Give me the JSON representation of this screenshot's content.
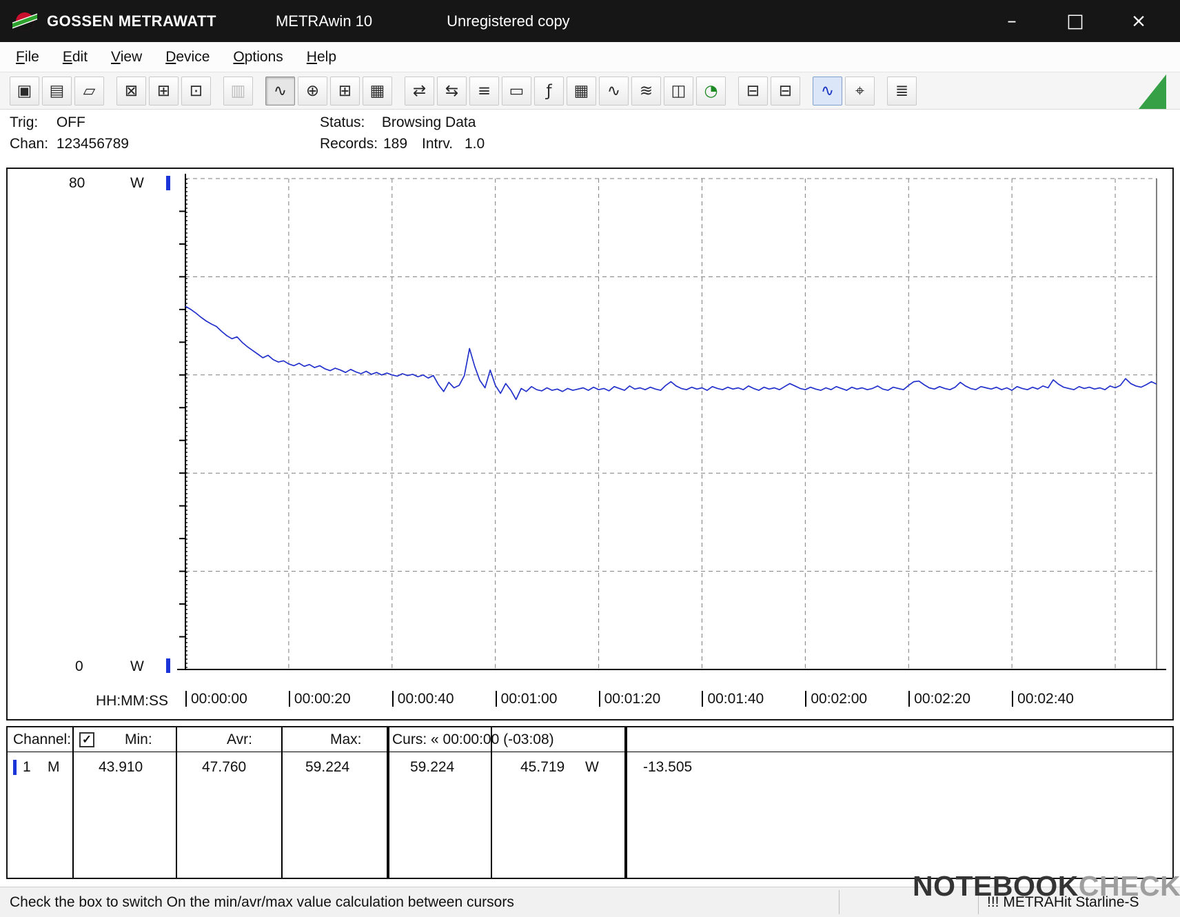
{
  "titlebar": {
    "brand": "GOSSEN METRAWATT",
    "app": "METRAwin 10",
    "license": "Unregistered copy",
    "controls": {
      "minimize": "–",
      "maximize": "□",
      "close": "×"
    }
  },
  "menu": {
    "items": [
      "File",
      "Edit",
      "View",
      "Device",
      "Options",
      "Help"
    ]
  },
  "toolbar": {
    "buttons": [
      {
        "name": "save-button",
        "icon": "floppy-save-icon",
        "glyph": "▣"
      },
      {
        "name": "save-as-button",
        "icon": "floppy-edit-icon",
        "glyph": "▤"
      },
      {
        "name": "open-button",
        "icon": "open-folder-icon",
        "glyph": "▱"
      },
      {
        "sep": true
      },
      {
        "name": "export-data-button",
        "icon": "export-box-icon",
        "glyph": "⊠"
      },
      {
        "name": "delete-data-button",
        "icon": "delete-box-icon",
        "glyph": "⊞"
      },
      {
        "name": "import-data-button",
        "icon": "import-box-icon",
        "glyph": "⊡"
      },
      {
        "sep": true
      },
      {
        "name": "numeric-display-button",
        "icon": "numeric-display-icon",
        "glyph": "▥",
        "state": "disabled"
      },
      {
        "sep": true
      },
      {
        "name": "line-chart-view-button",
        "icon": "line-chart-icon",
        "glyph": "∿",
        "state": "pressed"
      },
      {
        "name": "xy-view-button",
        "icon": "crosshair-icon",
        "glyph": "⊕"
      },
      {
        "name": "table-view-button",
        "icon": "table-grid-icon",
        "glyph": "⊞"
      },
      {
        "name": "histogram-view-button",
        "icon": "histogram-icon",
        "glyph": "▦"
      },
      {
        "sep": true
      },
      {
        "name": "device-settings-button",
        "icon": "device-transfer-icon",
        "glyph": "⇄"
      },
      {
        "name": "device-read-button",
        "icon": "device-read-icon",
        "glyph": "⇆"
      },
      {
        "name": "channel-select-button",
        "icon": "channel-list-icon",
        "glyph": "≡"
      },
      {
        "name": "monitor-button",
        "icon": "monitor-icon",
        "glyph": "▭"
      },
      {
        "name": "function-button",
        "icon": "function-fx-icon",
        "glyph": "ƒ"
      },
      {
        "name": "calculator-button",
        "icon": "calculator-icon",
        "glyph": "▦"
      },
      {
        "name": "waveform-small-button",
        "icon": "waveform-narrow-icon",
        "glyph": "∿"
      },
      {
        "name": "waveform-large-button",
        "icon": "waveform-wide-icon",
        "glyph": "≋"
      },
      {
        "name": "data-logger-button",
        "icon": "data-logger-icon",
        "glyph": "◫"
      },
      {
        "name": "timer-button",
        "icon": "stopwatch-icon",
        "glyph": "◔",
        "state": "green"
      },
      {
        "sep": true
      },
      {
        "name": "print-preview-button",
        "icon": "print-preview-icon",
        "glyph": "⊟"
      },
      {
        "name": "print-button",
        "icon": "printer-icon",
        "glyph": "⊟"
      },
      {
        "sep": true
      },
      {
        "name": "zoom-signal-button",
        "icon": "zoom-waveform-icon",
        "glyph": "∿",
        "state": "active"
      },
      {
        "name": "zoom-search-button",
        "icon": "zoom-lens-icon",
        "glyph": "⌖"
      },
      {
        "sep": true
      },
      {
        "name": "annotation-button",
        "icon": "note-icon",
        "glyph": "≣"
      }
    ]
  },
  "status_panel": {
    "trig_label": "Trig:",
    "trig_value": "OFF",
    "chan_label": "Chan:",
    "chan_value": "123456789",
    "status_label": "Status:",
    "status_value": "Browsing Data",
    "records_label": "Records:",
    "records_value": "189",
    "interval_label": "Intrv.",
    "interval_value": "1.0"
  },
  "chart_data": {
    "type": "line",
    "y_axis": {
      "max_label": "80",
      "min_label": "0",
      "unit": "W",
      "ylim": [
        0,
        80
      ],
      "gridline_values": [
        16,
        32,
        48,
        64
      ]
    },
    "x_axis": {
      "label": "HH:MM:SS",
      "tick_labels": [
        "00:00:00",
        "00:00:20",
        "00:00:40",
        "00:01:00",
        "00:01:20",
        "00:01:40",
        "00:02:00",
        "00:02:20",
        "00:02:40"
      ],
      "tick_interval_s": 20,
      "total_seconds": 188
    },
    "grid": true,
    "legend": "none",
    "cursors": {
      "left_s": 0,
      "right_s": 188
    },
    "series": [
      {
        "name": "channel-1-power-W",
        "color": "#2231cc",
        "interval_s": 1,
        "values": [
          59.2,
          58.7,
          58.1,
          57.4,
          56.8,
          56.3,
          55.9,
          55.1,
          54.4,
          53.9,
          54.2,
          53.3,
          52.6,
          52.0,
          51.4,
          50.8,
          51.2,
          50.5,
          50.1,
          50.3,
          49.8,
          49.5,
          49.9,
          49.4,
          49.7,
          49.2,
          49.5,
          49.0,
          48.7,
          49.1,
          48.8,
          48.4,
          48.9,
          48.5,
          48.2,
          48.6,
          48.1,
          48.4,
          48.0,
          48.3,
          48.0,
          47.8,
          48.2,
          47.9,
          48.1,
          47.7,
          48.0,
          47.5,
          47.9,
          46.4,
          45.3,
          46.8,
          45.9,
          46.3,
          47.9,
          52.3,
          49.4,
          47.1,
          45.9,
          48.8,
          46.3,
          45.0,
          46.6,
          45.5,
          44.0,
          45.8,
          45.3,
          46.1,
          45.6,
          45.4,
          45.9,
          45.5,
          45.7,
          45.3,
          45.8,
          45.5,
          45.7,
          45.9,
          45.5,
          46.0,
          45.6,
          45.8,
          45.4,
          46.1,
          45.8,
          45.5,
          46.2,
          45.7,
          45.9,
          45.6,
          46.0,
          45.7,
          45.5,
          46.3,
          46.9,
          46.2,
          45.8,
          45.6,
          46.0,
          45.7,
          45.9,
          45.5,
          46.1,
          45.8,
          45.6,
          46.0,
          45.7,
          45.9,
          45.6,
          46.2,
          45.8,
          45.5,
          46.0,
          45.7,
          45.9,
          45.6,
          46.1,
          46.6,
          46.2,
          45.8,
          45.6,
          46.0,
          45.7,
          45.5,
          45.9,
          45.6,
          46.1,
          45.8,
          45.5,
          46.0,
          45.7,
          45.9,
          45.6,
          45.8,
          46.2,
          45.7,
          45.5,
          46.0,
          45.8,
          45.6,
          46.3,
          46.9,
          47.0,
          46.4,
          45.9,
          45.7,
          46.1,
          45.8,
          45.6,
          46.0,
          46.8,
          46.2,
          45.8,
          45.6,
          46.1,
          45.9,
          45.7,
          46.0,
          45.6,
          45.9,
          45.5,
          46.1,
          45.8,
          45.6,
          46.0,
          45.7,
          46.2,
          45.9,
          47.2,
          46.5,
          46.0,
          45.8,
          45.6,
          46.1,
          45.8,
          46.0,
          45.7,
          45.9,
          45.6,
          46.2,
          45.9,
          46.3,
          47.4,
          46.6,
          46.2,
          46.0,
          46.4,
          46.9,
          46.5
        ]
      }
    ]
  },
  "cursor_table": {
    "headers": {
      "channel": "Channel:",
      "min": "Min:",
      "avr": "Avr:",
      "max": "Max:",
      "curs": "Curs: « 00:00:00 (-03:08)"
    },
    "checkbox_checked": true,
    "checkbox_glyph": "✓",
    "row": {
      "channel": "1",
      "mode": "M",
      "min": "43.910",
      "avr": "47.760",
      "max": "59.224",
      "curs_a": "59.224",
      "curs_b": "45.719",
      "unit": "W",
      "delta": "-13.505"
    }
  },
  "status_bar": {
    "message": "Check the box to switch On the min/avr/max value calculation between cursors",
    "device": "!!! METRAHit Starline-S"
  },
  "watermark": {
    "text_bold": "NOTEBOOK",
    "text_light": "CHECK"
  }
}
